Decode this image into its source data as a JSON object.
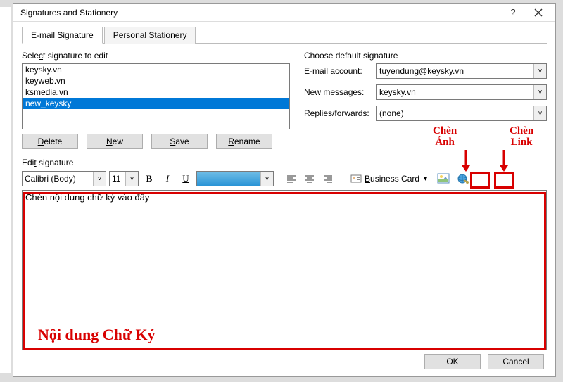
{
  "window": {
    "title": "Signatures and Stationery"
  },
  "tabs": {
    "email_signature": "E-mail Signature",
    "personal_stationery": "Personal Stationery"
  },
  "left": {
    "select_label": "Select signature to edit",
    "items": [
      "keysky.vn",
      "keyweb.vn",
      "ksmedia.vn",
      "new_keysky"
    ],
    "selected_index": 3,
    "buttons": {
      "delete": "Delete",
      "new": "New",
      "save": "Save",
      "rename": "Rename"
    }
  },
  "right": {
    "choose_label": "Choose default signature",
    "email_account_label": "E-mail account:",
    "email_account_value": "tuyendung@keysky.vn",
    "new_messages_label": "New messages:",
    "new_messages_value": "keysky.vn",
    "replies_label": "Replies/forwards:",
    "replies_value": "(none)"
  },
  "edit_label": "Edit signature",
  "toolbar": {
    "font_name": "Calibri (Body)",
    "font_size": "11",
    "bold": "B",
    "italic": "I",
    "underline": "U",
    "business_card": "Business Card"
  },
  "editor": {
    "content": "Chèn nội dung chữ ký vào đây"
  },
  "bottom": {
    "ok": "OK",
    "cancel": "Cancel"
  },
  "annotations": {
    "insert_image_line1": "Chèn",
    "insert_image_line2": "Ảnh",
    "insert_link_line1": "Chèn",
    "insert_link_line2": "Link",
    "content_label": "Nội dung Chữ Ký"
  }
}
